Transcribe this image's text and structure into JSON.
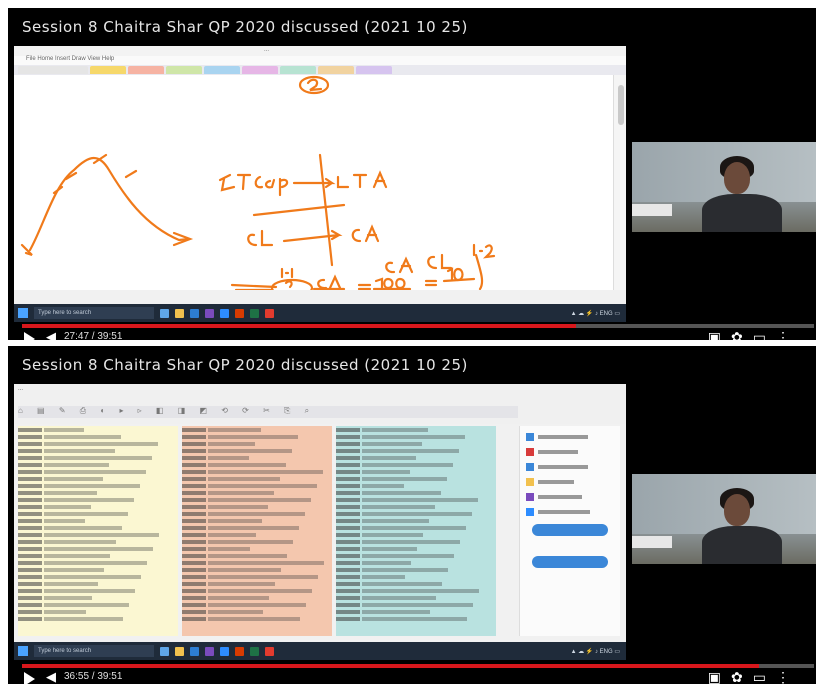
{
  "panels": [
    {
      "video_title": "Session 8  Chaitra Shar  QP 2020 discussed (2021 10 25)",
      "time": "27:47 / 39:51",
      "progress": 0.7,
      "app_title": "...",
      "ribbon": "File  Home  Insert  Draw  View  Help",
      "taskbar_search": "Type here to search"
    },
    {
      "video_title": "Session 8  Chaitra Shar  QP 2020 discussed (2021 10 25)",
      "time": "36:55 / 39:51",
      "progress": 0.93,
      "app_title": "...",
      "taskbar_search": "Type here to search"
    }
  ],
  "colors": {
    "progress": "#d8171c",
    "ink": "#f07a1a"
  },
  "icons": [
    "play-icon",
    "volume-icon",
    "captions-icon",
    "settings-icon",
    "miniplayer-icon",
    "fullscreen-icon"
  ]
}
